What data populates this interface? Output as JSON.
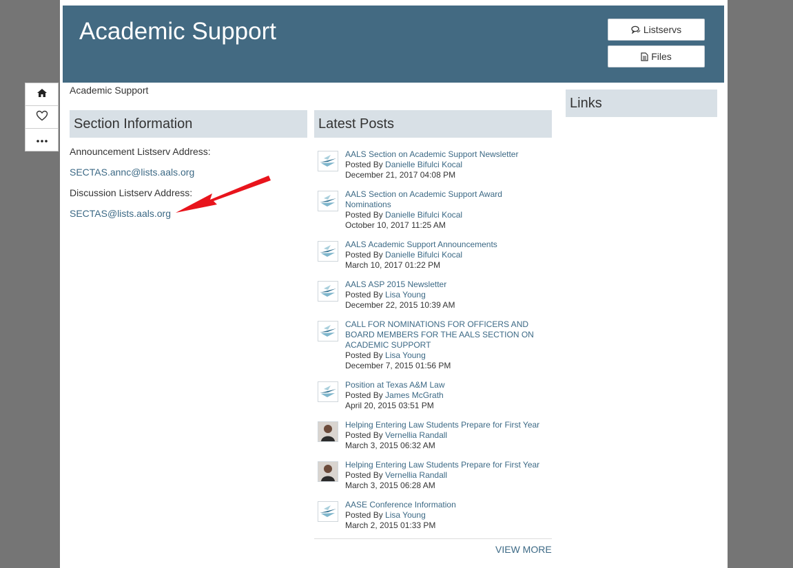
{
  "header": {
    "title": "Academic Support",
    "buttons": [
      {
        "label": "Listservs",
        "icon": "comments-icon"
      },
      {
        "label": "Files",
        "icon": "file-icon"
      }
    ]
  },
  "side_tools": [
    "home-icon",
    "heart-icon",
    "more-icon"
  ],
  "breadcrumb": "Academic Support",
  "section_info": {
    "heading": "Section Information",
    "announcement_label": "Announcement Listserv Address:",
    "announcement_email": "SECTAS.annc@lists.aals.org",
    "discussion_label": "Discussion Listserv Address:",
    "discussion_email": "SECTAS@lists.aals.org"
  },
  "latest_posts": {
    "heading": "Latest Posts",
    "posted_by_prefix": "Posted By ",
    "view_more": "VIEW MORE",
    "items": [
      {
        "title": "AALS Section on Academic Support Newsletter",
        "author": "Danielle Bifulci Kocal",
        "date": "December 21, 2017 04:08 PM",
        "thumb": "aals-logo"
      },
      {
        "title": "AALS Section on Academic Support Award Nominations",
        "author": "Danielle Bifulci Kocal",
        "date": "October 10, 2017 11:25 AM",
        "thumb": "aals-logo"
      },
      {
        "title": "AALS Academic Support Announcements",
        "author": "Danielle Bifulci Kocal",
        "date": "March 10, 2017 01:22 PM",
        "thumb": "aals-logo"
      },
      {
        "title": "AALS ASP 2015 Newsletter",
        "author": "Lisa Young",
        "date": "December 22, 2015 10:39 AM",
        "thumb": "aals-logo"
      },
      {
        "title": "CALL FOR NOMINATIONS FOR OFFICERS AND BOARD MEMBERS FOR THE AALS SECTION ON ACADEMIC SUPPORT",
        "author": "Lisa Young",
        "date": "December 7, 2015 01:56 PM",
        "thumb": "aals-logo"
      },
      {
        "title": "Position at Texas A&M Law",
        "author": "James McGrath",
        "date": "April 20, 2015 03:51 PM",
        "thumb": "aals-logo"
      },
      {
        "title": "Helping Entering Law Students Prepare for First Year",
        "author": "Vernellia Randall",
        "date": "March 3, 2015 06:32 AM",
        "thumb": "person-photo"
      },
      {
        "title": "Helping Entering Law Students Prepare for First Year",
        "author": "Vernellia Randall",
        "date": "March 3, 2015 06:28 AM",
        "thumb": "person-photo"
      },
      {
        "title": "AASE Conference Information",
        "author": "Lisa Young",
        "date": "March 2, 2015 01:33 PM",
        "thumb": "aals-logo"
      }
    ]
  },
  "links": {
    "heading": "Links"
  },
  "colors": {
    "header_bg": "#436a82",
    "panel_bg": "#d8e0e6",
    "link": "#3c6985",
    "arrow": "#e8141c"
  }
}
